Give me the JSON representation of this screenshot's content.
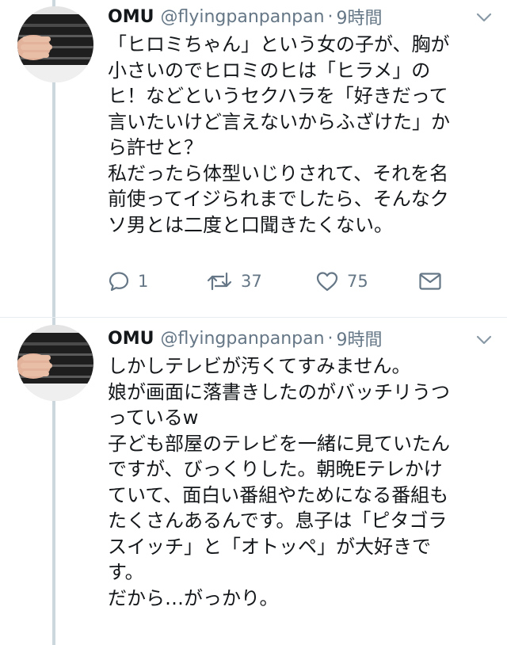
{
  "tweets": [
    {
      "name": "OMU",
      "handle": "@flyingpanpanpan",
      "separator": "·",
      "time": "9時間",
      "text": "「ヒロミちゃん」という女の子が、胸が\n小さいのでヒロミのヒは「ヒラメ」の\nヒ！などというセクハラを「好きだって\n言いたいけど言えないからふざけた」か\nら許せと？\n私だったら体型いじりされて、それを名\n前使ってイジられまでしたら、そんなク\nソ男とは二度と口聞きたくない。",
      "replies": "1",
      "retweets": "37",
      "likes": "75"
    },
    {
      "name": "OMU",
      "handle": "@flyingpanpanpan",
      "separator": "·",
      "time": "9時間",
      "text": "しかしテレビが汚くてすみません。\n娘が画面に落書きしたのがバッチリうつ\nっているw\n子ども部屋のテレビを一緒に見ていたん\nですが、びっくりした。朝晩Eテレかけ\nていて、面白い番組やためになる番組も\nたくさんあるんです。息子は「ピタゴラ\nスイッチ」と「オトッペ」が大好きで\nす。\nだから…がっかり。"
    }
  ],
  "icons": {
    "reply": "reply-icon",
    "retweet": "retweet-icon",
    "like": "heart-icon",
    "dm": "envelope-icon",
    "more": "chevron-down-icon"
  },
  "colors": {
    "text": "#14171a",
    "muted": "#657786",
    "thread_line": "#ccd6dd"
  }
}
